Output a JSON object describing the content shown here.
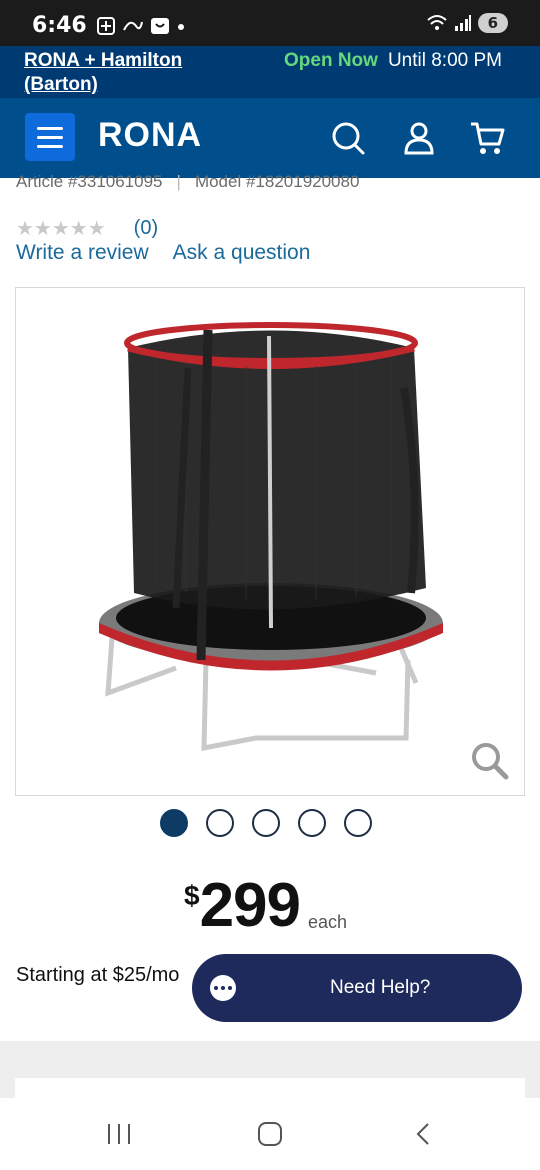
{
  "status_bar": {
    "time": "6:46",
    "battery": "6"
  },
  "store_bar": {
    "store_name": "RONA + Hamilton (Barton)",
    "open_status": "Open Now",
    "hours": "Until 8:00 PM"
  },
  "nav": {
    "logo": "RONA",
    "icons": [
      "menu-icon",
      "search-icon",
      "account-icon",
      "cart-icon"
    ]
  },
  "product": {
    "article": "Article #331061095",
    "model": "Model #18201920080",
    "stars": "★★★★★",
    "rating_count": "(0)",
    "write_review": "Write a review",
    "ask_question": "Ask a question",
    "image_count": 5,
    "active_image": 1,
    "price_currency": "$",
    "price_amount": "299",
    "price_unit": "each",
    "financing": "Starting at $25/mo"
  },
  "help": {
    "label": "Need Help?"
  },
  "colors": {
    "store_bar": "#003a73",
    "nav_bar": "#004f8c",
    "menu_button": "#0d6bdc",
    "link": "#1a6a9c",
    "help_button": "#1f2a5c",
    "open_now": "#63d97a"
  }
}
